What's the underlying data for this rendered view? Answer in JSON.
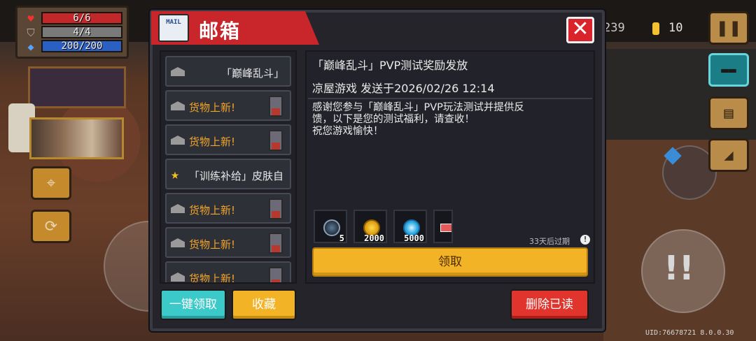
{
  "hud": {
    "hp": {
      "text": "6/6",
      "fraction": 1.0
    },
    "armor": {
      "text": "4/4",
      "fraction": 1.0
    },
    "energy": {
      "text": "200/200",
      "fraction": 1.0
    }
  },
  "top_right": {
    "gems_partial": "239",
    "coins": "10"
  },
  "uid_text": "UID:76678721 8.0.0.30",
  "mailbox": {
    "title": "邮箱",
    "icon_text": "MAIL",
    "close_label": "✕",
    "mails": [
      {
        "label": "「巅峰乱斗」",
        "icon": "envelope-icon",
        "color": "#e8e8e8"
      },
      {
        "label": "货物上新!",
        "icon": "envelope-icon",
        "color": "#f1a428"
      },
      {
        "label": "货物上新!",
        "icon": "envelope-icon",
        "color": "#f1a428"
      },
      {
        "label": "「训练补给」皮肤自",
        "icon": "star-icon",
        "color": "#e8e8e8"
      },
      {
        "label": "货物上新!",
        "icon": "envelope-icon",
        "color": "#f1a428"
      },
      {
        "label": "货物上新!",
        "icon": "envelope-icon",
        "color": "#f1a428"
      },
      {
        "label": "货物上新!",
        "icon": "envelope-icon",
        "color": "#f1a428"
      }
    ],
    "detail": {
      "title": "「巅峰乱斗」PVP测试奖励发放",
      "sender_line": "凉屋游戏 发送于2026/02/26 12:14",
      "body_line1": "感谢您参与「巅峰乱斗」PVP玩法测试并提供反",
      "body_line2": "馈，以下是您的测试福利，请查收！",
      "body_line3": "祝您游戏愉快！",
      "rewards": [
        {
          "icon": "feather-token-icon",
          "count": "5"
        },
        {
          "icon": "gold-coin-icon",
          "count": "2000"
        },
        {
          "icon": "blue-gem-icon",
          "count": "5000"
        },
        {
          "icon": "ticket-icon",
          "count": ""
        }
      ],
      "expire": "33天后过期",
      "claim_label": "领取"
    },
    "buttons": {
      "claim_all": "一键领取",
      "favorite": "收藏",
      "delete_read": "删除已读"
    }
  },
  "colors": {
    "header_red": "#c8262b",
    "accent_gold": "#f3b327",
    "accent_cyan": "#3cc9c9",
    "delete_red": "#e0342c"
  }
}
